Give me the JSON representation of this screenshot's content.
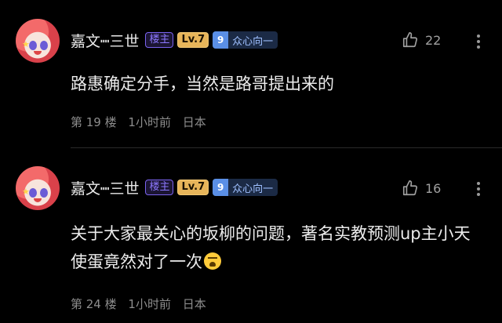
{
  "comments": [
    {
      "username": "嘉文┉三世",
      "host_badge": "楼主",
      "level_badge": "Lv.7",
      "fan_level": "9",
      "fan_name": "众心向一",
      "likes": "22",
      "text": "路惠确定分手，当然是路哥提出来的",
      "floor": "第 19 楼",
      "time": "1小时前",
      "location": "日本"
    },
    {
      "username": "嘉文┉三世",
      "host_badge": "楼主",
      "level_badge": "Lv.7",
      "fan_level": "9",
      "fan_name": "众心向一",
      "likes": "16",
      "text": "关于大家最关心的坂柳的问题，著名实教预测up主小天使蛋竟然对了一次",
      "floor": "第 24 楼",
      "time": "1小时前",
      "location": "日本"
    }
  ],
  "colors": {
    "background": "#000000",
    "host_badge": "#7a63f0",
    "level_badge": "#e7b55a",
    "fan_badge": "#5a8fe6"
  },
  "icons": [
    "thumbs-up-icon",
    "more-vertical-icon",
    "crying-emoji-icon"
  ]
}
